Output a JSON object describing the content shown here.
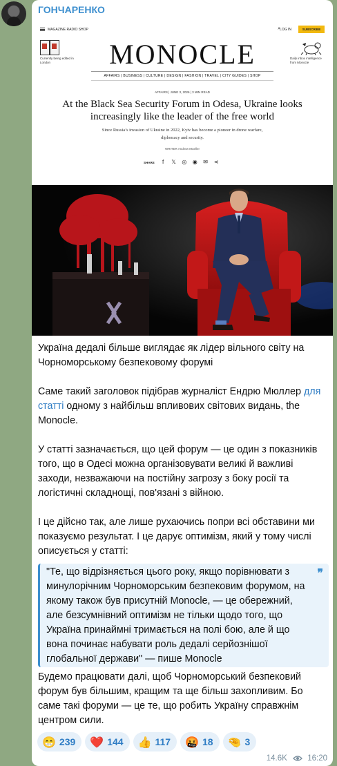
{
  "channel": {
    "name": "ГОНЧАРЕНКО"
  },
  "article": {
    "topbar": {
      "menu": "MAGAZINE  RADIO  SHOP",
      "login": "LOG IN",
      "subscribe": "SUBSCRIBE"
    },
    "editing_note": "Currently being edited in London",
    "logo": "MONOCLE",
    "daily_note": "Daily inbox intelligence from Monocle",
    "nav": "AFFAIRS  |  BUSINESS  |  CULTURE  |  DESIGN  |  FASHION  |  TRAVEL  |  CITY GUIDES  |  SHOP",
    "kicker": "AFFAIRS | JUNE 3, 2026 | 3 MIN READ",
    "headline": "At the Black Sea Security Forum in Odesa, Ukraine looks increasingly like the leader of the free world",
    "standfirst": "Since Russia’s invasion of Ukraine in 2022, Kyiv has become a pioneer in drone warfare, diplomacy and security.",
    "writer": "WRITER Andrew Mueller",
    "share_label": "SHARE"
  },
  "message": {
    "p1": "Україна дедалі більше виглядає як лідер вільного світу на Чорноморському безпековому форумі",
    "p2_before": "Саме такий заголовок підібрав журналіст Ендрю Мюллер ",
    "p2_link": "для статті",
    "p2_after": " одному з найбільш впливових світових видань, the Monocle.",
    "p3": "У статті зазначається, що цей форум — це один з показників того, що в Одесі можна організовувати великі й важливі заходи, незважаючи на постійну загрозу з боку росії та логістичні складнощі, пов'язані з війною.",
    "p4": "І це дійсно так, але лише рухаючись попри всі обставини ми показуємо результат. І це дарує оптимізм, який у тому числі описується у статті:",
    "quote": "\"Те, що відрізняється цього року, якщо порівнювати з минулорічним Чорноморським безпековим форумом, на якому також був присутній Monocle, — це обережний, але безсумнівний оптимізм не тільки щодо того, що Україна принаймні тримається на полі бою, але й що вона починає набувати роль дедалі серйознішої глобальної держави\" — пише Monocle",
    "p5": "Будемо працювати далі, щоб Чорноморський безпековий форум був більшим, кращим та ще більш захопливим. Бо саме такі форуми — це те, що робить Україну справжнім центром сили."
  },
  "reactions": [
    {
      "emoji": "😁",
      "icon": "grin-emoji",
      "count": "239"
    },
    {
      "emoji": "❤️",
      "icon": "heart-emoji",
      "count": "144"
    },
    {
      "emoji": "👍",
      "icon": "thumbs-up-emoji",
      "count": "117"
    },
    {
      "emoji": "🤬",
      "icon": "angry-emoji",
      "count": "18"
    },
    {
      "emoji": "🤏",
      "icon": "pinch-emoji",
      "count": "3"
    }
  ],
  "meta": {
    "views": "14.6K",
    "time": "16:20"
  },
  "colors": {
    "accent": "#3d8fcf",
    "reaction_bg": "#e6f0f9",
    "subscribe": "#f2b90f"
  }
}
